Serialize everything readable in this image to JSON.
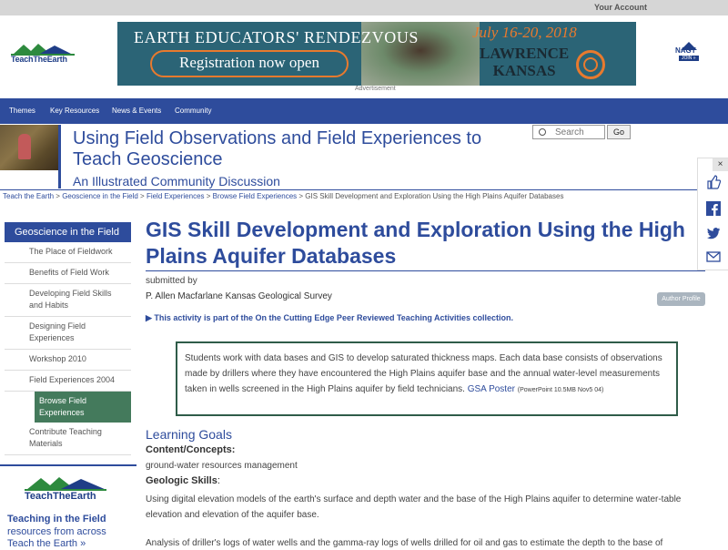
{
  "topbar": {
    "account": "Your Account"
  },
  "logo": {
    "text": "TeachTheEarth"
  },
  "banner": {
    "line1": "EARTH EDUCATORS' RENDEZVOUS",
    "cta": "Registration now open",
    "dates": "July 16-20, 2018",
    "location_1": "LAWRENCE",
    "location_2": "KANSAS",
    "ad_label": "Advertisement"
  },
  "nagt": {
    "name": "NAGT",
    "join": "JOIN »"
  },
  "nav": {
    "items": [
      "Themes",
      "Key Resources",
      "News & Events",
      "Community"
    ]
  },
  "site": {
    "title": "Using Field Observations and Field Experiences to Teach Geoscience",
    "subtitle": "An Illustrated Community Discussion"
  },
  "search": {
    "placeholder": "Search",
    "button": "Go"
  },
  "breadcrumb": {
    "items": [
      "Teach the Earth",
      "Geoscience in the Field",
      "Field Experiences",
      "Browse Field Experiences"
    ],
    "current": "GIS Skill Development and Exploration Using the High Plains Aquifer Databases",
    "sep": ">"
  },
  "sidebar": {
    "heading": "Geoscience in the Field",
    "items": [
      "The Place of Fieldwork",
      "Benefits of Field Work",
      "Developing Field Skills and Habits",
      "Designing Field Experiences",
      "Workshop 2010",
      "Field Experiences 2004",
      "Browse Field Experiences",
      "Contribute Teaching Materials"
    ]
  },
  "tte_box": {
    "logo": "TeachTheEarth",
    "line1": "Teaching in the Field",
    "line2": "resources from across",
    "line3": "Teach the Earth »"
  },
  "page": {
    "title": "GIS Skill Development and Exploration Using the High Plains Aquifer Databases",
    "submitted_by": "submitted by",
    "author": "P. Allen Macfarlane Kansas Geological Survey",
    "author_button": "Author Profile",
    "collection": "This activity is part of the On the Cutting Edge Peer Reviewed Teaching Activities collection.",
    "summary": "Students work with data bases and GIS to develop saturated thickness maps. Each data base consists of observations made by drillers where they have encountered the High Plains aquifer base and the annual water-level measurements taken in wells screened in the High Plains aquifer by field technicians.",
    "summary_link": "GSA Poster",
    "summary_link_note": "(PowerPoint 10.5MB Nov5 04)",
    "learning_goals": "Learning Goals",
    "content_concepts": "Content/Concepts:",
    "content_item": "ground-water resources management",
    "geologic_skills": "Geologic Skills",
    "geologic_colon": ":",
    "skill_1": "Using digital elevation models of the earth's surface and depth water and the base of the High Plains aquifer to determine water-table elevation and elevation of the aquifer base.",
    "skill_2": "Analysis of driller's logs of water wells and the gamma-ray logs of wells drilled for oil and gas to estimate the depth to the base of"
  },
  "share": {
    "close": "×",
    "icons": [
      "thumbs-up",
      "facebook",
      "twitter",
      "email",
      "share"
    ]
  }
}
